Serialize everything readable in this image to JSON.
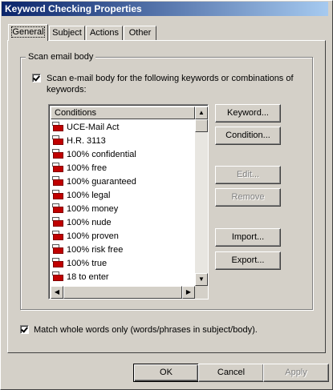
{
  "window": {
    "title": "Keyword Checking Properties"
  },
  "tabs": [
    {
      "label": "General"
    },
    {
      "label": "Subject"
    },
    {
      "label": "Actions"
    },
    {
      "label": "Other"
    }
  ],
  "group": {
    "label": "Scan email body"
  },
  "scan_checkbox": {
    "checked": true,
    "label_line1": "Scan e-mail body for the following keywords or combinations of",
    "label_line2": "keywords:"
  },
  "list": {
    "header": "Conditions",
    "items": [
      "UCE-Mail Act",
      "H.R. 3113",
      "100% confidential",
      "100% free",
      "100% guaranteed",
      "100% legal",
      "100% money",
      "100% nude",
      "100% proven",
      "100% risk free",
      "100% true",
      "18 to enter"
    ]
  },
  "side_buttons": {
    "keyword": "Keyword...",
    "condition": "Condition...",
    "edit": "Edit...",
    "remove": "Remove",
    "import": "Import...",
    "export": "Export..."
  },
  "match_checkbox": {
    "checked": true,
    "label": "Match whole words only (words/phrases in subject/body)."
  },
  "footer": {
    "ok": "OK",
    "cancel": "Cancel",
    "apply": "Apply"
  }
}
